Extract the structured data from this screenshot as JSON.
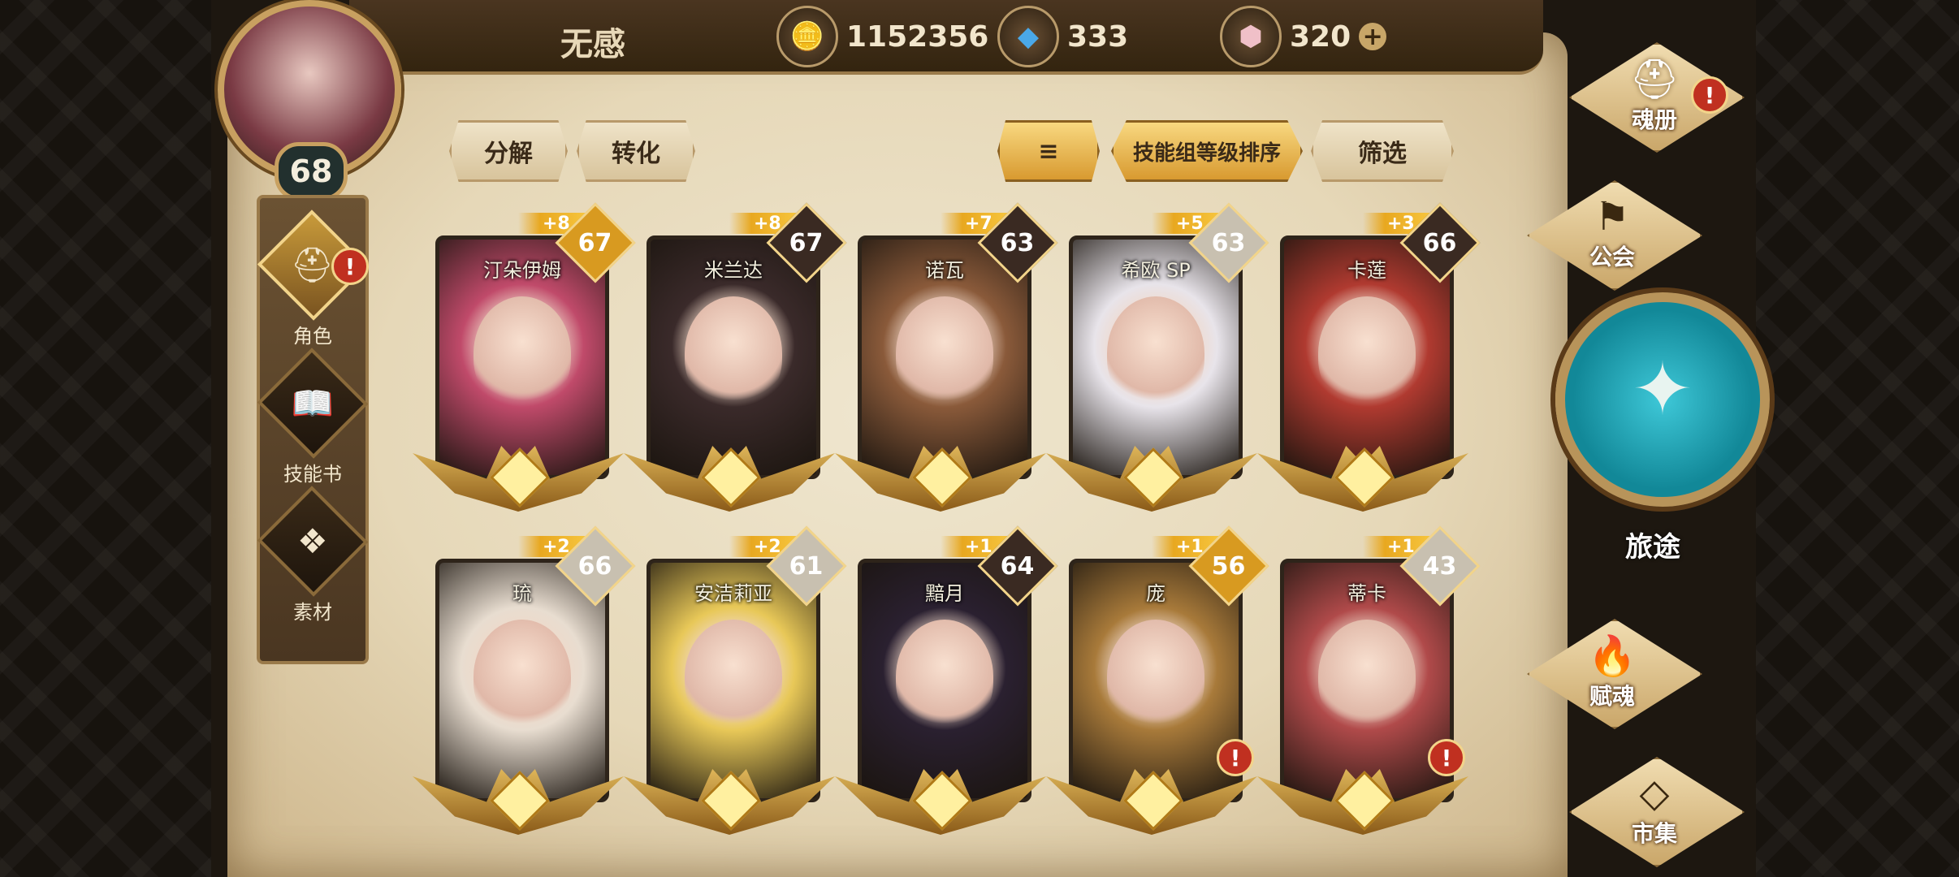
{
  "player": {
    "name": "无感",
    "level": "68"
  },
  "currencies": {
    "gold": {
      "value": "1152356",
      "icon": "gold-coin-icon"
    },
    "crystal": {
      "value": "333",
      "icon": "blue-crystal-icon"
    },
    "gem": {
      "value": "320",
      "icon": "pink-gem-icon",
      "add": "+"
    }
  },
  "actions": {
    "decompose": "分解",
    "convert": "转化",
    "sort_label": "技能组等级排序",
    "filter": "筛选"
  },
  "left_nav": [
    {
      "label": "角色",
      "icon": "helmet-icon",
      "alert": "!"
    },
    {
      "label": "技能书",
      "icon": "book-icon"
    },
    {
      "label": "素材",
      "icon": "material-icon"
    }
  ],
  "right_nav": {
    "soul_book": {
      "label": "魂册",
      "alert": "!"
    },
    "guild": {
      "label": "公会"
    },
    "journey": {
      "label": "旅途"
    },
    "soul_gift": {
      "label": "赋魂"
    },
    "market": {
      "label": "市集"
    }
  },
  "cards": [
    {
      "name": "汀朵伊姆",
      "plus": "+8",
      "level": "67",
      "color": "#c04a6a",
      "lvcolor": "#d89a20"
    },
    {
      "name": "米兰达",
      "plus": "+8",
      "level": "67",
      "color": "#3a2a2a",
      "lvcolor": "#3a2a22"
    },
    {
      "name": "诺瓦",
      "plus": "+7",
      "level": "63",
      "color": "#8a5a3a",
      "lvcolor": "#3a2a22"
    },
    {
      "name": "希欧 SP",
      "plus": "+5",
      "level": "63",
      "color": "#e8e4ea",
      "lvcolor": "#c8c0b0"
    },
    {
      "name": "卡莲",
      "plus": "+3",
      "level": "66",
      "color": "#b03a30",
      "lvcolor": "#3a2a22"
    },
    {
      "name": "琉",
      "plus": "+2",
      "level": "66",
      "color": "#e8ddd0",
      "lvcolor": "#c8c0b0"
    },
    {
      "name": "安洁莉亚",
      "plus": "+2",
      "level": "61",
      "color": "#e8c858",
      "lvcolor": "#c8c0b0"
    },
    {
      "name": "黯月",
      "plus": "+1",
      "level": "64",
      "color": "#2a2030",
      "lvcolor": "#3a2a22"
    },
    {
      "name": "庞",
      "plus": "+1",
      "level": "56",
      "color": "#a87a3a",
      "lvcolor": "#d89a20",
      "alert": "!"
    },
    {
      "name": "蒂卡",
      "plus": "+1",
      "level": "43",
      "color": "#b04a4a",
      "lvcolor": "#c8c0b0",
      "alert": "!"
    }
  ]
}
